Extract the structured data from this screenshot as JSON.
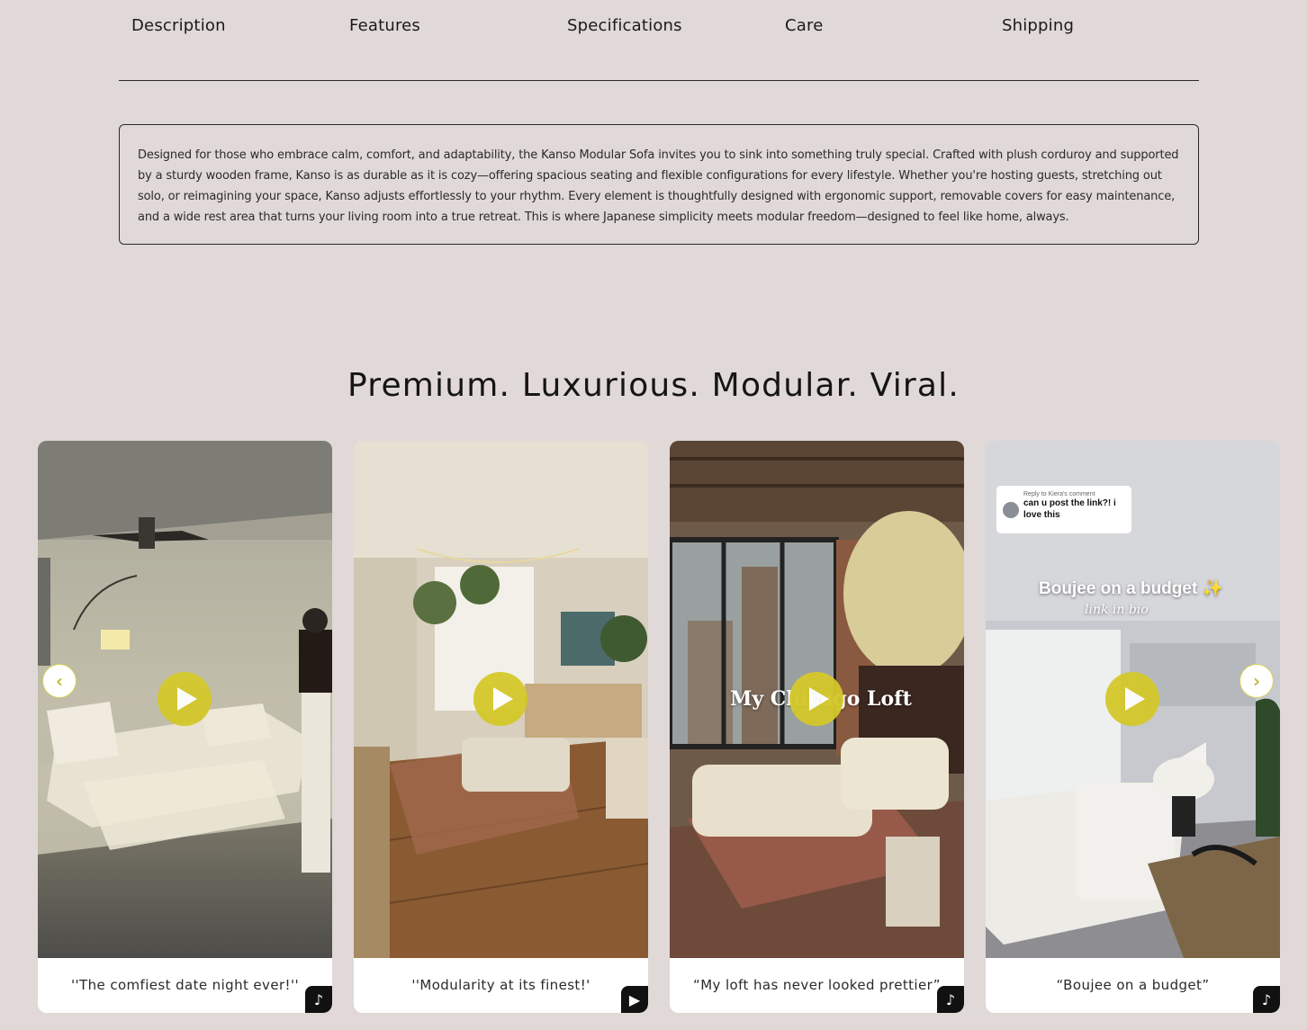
{
  "tabs": [
    "Description",
    "Features",
    "Specifications",
    "Care",
    "Shipping"
  ],
  "description": "Designed for those who embrace calm, comfort, and adaptability, the Kanso Modular Sofa invites you to sink into something truly special. Crafted with plush corduroy and supported by a sturdy wooden frame, Kanso is as durable as it is cozy—offering spacious seating and flexible configurations for every lifestyle. Whether you're hosting guests, stretching out solo, or reimagining your space, Kanso adjusts effortlessly to your rhythm. Every element is thoughtfully designed with ergonomic support, removable covers for easy maintenance, and a wide rest area that turns your living room into a true retreat. This is where Japanese simplicity meets modular freedom—designed to feel like home, always.",
  "heading": "Premium. Luxurious. Modular. Viral.",
  "videos": [
    {
      "caption": "''The comfiest date night ever!''",
      "platform_icon": "tiktok-icon"
    },
    {
      "caption": "''Modularity at its finest!'",
      "platform_icon": "youtube-shorts-icon"
    },
    {
      "caption": "“My loft has never looked prettier”",
      "platform_icon": "tiktok-icon",
      "overlay": "My Chicago Loft"
    },
    {
      "caption": "“Boujee on a budget”",
      "platform_icon": "tiktok-icon",
      "overlay": "Boujee on a budget ✨",
      "overlay_sub": "link in bio",
      "comment_reply": "Reply to Kiera's comment",
      "comment_text": "can u post the link?! i love this"
    }
  ],
  "carousel": {
    "prev": "‹",
    "next": "›"
  },
  "colors": {
    "background": "#e0d9d7",
    "play_button": "#d4c82a",
    "accent_arrow": "#c9b93a"
  }
}
